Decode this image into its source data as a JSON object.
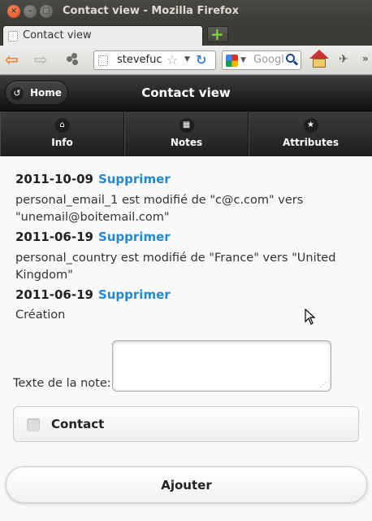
{
  "window": {
    "title": "Contact view - Mozilla Firefox",
    "controls": [
      "close",
      "minimize",
      "maximize"
    ]
  },
  "browser": {
    "tab_label": "Contact view",
    "new_tab_icon": "plus-icon",
    "url_text": "stevefuc",
    "search_placeholder": "Googl"
  },
  "app": {
    "home_label": "Home",
    "header_title": "Contact view",
    "tabs": [
      {
        "label": "Info",
        "icon": "home-icon"
      },
      {
        "label": "Notes",
        "icon": "grid-icon"
      },
      {
        "label": "Attributes",
        "icon": "star-icon"
      }
    ]
  },
  "history": [
    {
      "date": "2011-10-09",
      "action": "Supprimer",
      "text": "personal_email_1 est modifié de \"c@c.com\" vers \"unemail@boitemail.com\""
    },
    {
      "date": "2011-06-19",
      "action": "Supprimer",
      "text": "personal_country est modifié de \"France\" vers \"United Kingdom\""
    },
    {
      "date": "2011-06-19",
      "action": "Supprimer",
      "text": "Création"
    }
  ],
  "form": {
    "note_label": "Texte de la note:",
    "note_value": "",
    "checkbox_label": "Contact",
    "checkbox_checked": false,
    "submit_label": "Ajouter"
  },
  "colors": {
    "link": "#2489ce",
    "header_bg": "#222222",
    "page_bg": "#f9f9f9"
  }
}
